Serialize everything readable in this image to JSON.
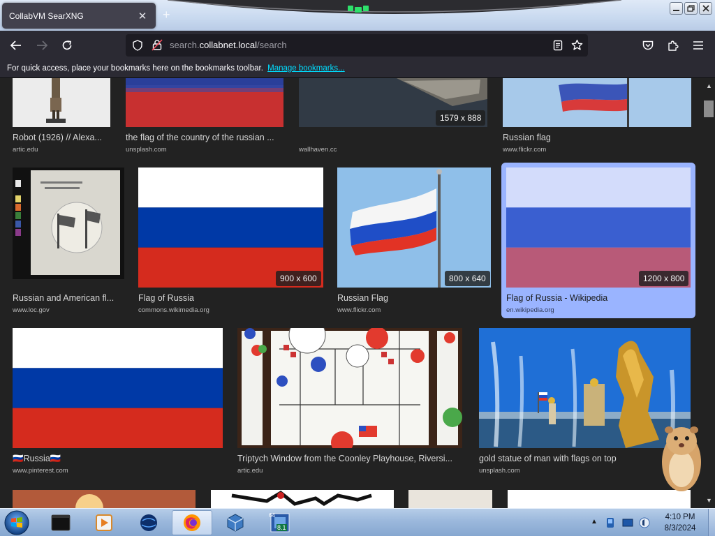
{
  "browser": {
    "tab_title": "CollabVM SearXNG",
    "url_scheme": "search.",
    "url_host": "collabnet.local",
    "url_path": "/search",
    "bookmarks_message": "For quick access, place your bookmarks here on the bookmarks toolbar.",
    "bookmarks_link": "Manage bookmarks..."
  },
  "results": [
    {
      "caption": "Robot (1926) // Alexa...",
      "source": "artic.edu"
    },
    {
      "caption": "the flag of the country of the russian ...",
      "source": "unsplash.com"
    },
    {
      "caption": "",
      "source": "wallhaven.cc",
      "dims": "1579 x 888"
    },
    {
      "caption": "Russian flag",
      "source": "www.flickr.com"
    },
    {
      "caption": "Russian and American fl...",
      "source": "www.loc.gov"
    },
    {
      "caption": "Flag of Russia",
      "source": "commons.wikimedia.org",
      "dims": "900 x 600"
    },
    {
      "caption": "Russian Flag",
      "source": "www.flickr.com",
      "dims": "800 x 640"
    },
    {
      "caption": "Flag of Russia - Wikipedia",
      "source": "en.wikipedia.org",
      "dims": "1200 x 800"
    },
    {
      "caption": "🇷🇺Russia🇷🇺",
      "source": "www.pinterest.com"
    },
    {
      "caption": "Triptych Window from the Coonley Playhouse, Riversi...",
      "source": "artic.edu"
    },
    {
      "caption": "gold statue of man with flags on top",
      "source": "unsplash.com"
    }
  ],
  "taskbar": {
    "time": "4:10 PM",
    "date": "8/3/2024",
    "badge_top": "64",
    "badge_bottom": "8.1"
  }
}
